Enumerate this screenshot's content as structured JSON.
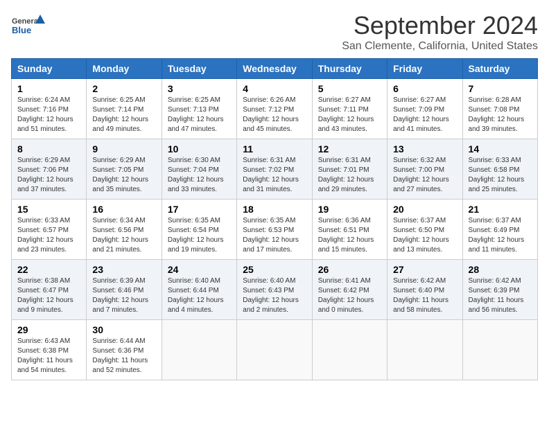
{
  "header": {
    "logo_general": "General",
    "logo_blue": "Blue",
    "month_title": "September 2024",
    "location": "San Clemente, California, United States"
  },
  "weekdays": [
    "Sunday",
    "Monday",
    "Tuesday",
    "Wednesday",
    "Thursday",
    "Friday",
    "Saturday"
  ],
  "weeks": [
    [
      {
        "day": "1",
        "sunrise": "6:24 AM",
        "sunset": "7:16 PM",
        "daylight": "12 hours and 51 minutes."
      },
      {
        "day": "2",
        "sunrise": "6:25 AM",
        "sunset": "7:14 PM",
        "daylight": "12 hours and 49 minutes."
      },
      {
        "day": "3",
        "sunrise": "6:25 AM",
        "sunset": "7:13 PM",
        "daylight": "12 hours and 47 minutes."
      },
      {
        "day": "4",
        "sunrise": "6:26 AM",
        "sunset": "7:12 PM",
        "daylight": "12 hours and 45 minutes."
      },
      {
        "day": "5",
        "sunrise": "6:27 AM",
        "sunset": "7:11 PM",
        "daylight": "12 hours and 43 minutes."
      },
      {
        "day": "6",
        "sunrise": "6:27 AM",
        "sunset": "7:09 PM",
        "daylight": "12 hours and 41 minutes."
      },
      {
        "day": "7",
        "sunrise": "6:28 AM",
        "sunset": "7:08 PM",
        "daylight": "12 hours and 39 minutes."
      }
    ],
    [
      {
        "day": "8",
        "sunrise": "6:29 AM",
        "sunset": "7:06 PM",
        "daylight": "12 hours and 37 minutes."
      },
      {
        "day": "9",
        "sunrise": "6:29 AM",
        "sunset": "7:05 PM",
        "daylight": "12 hours and 35 minutes."
      },
      {
        "day": "10",
        "sunrise": "6:30 AM",
        "sunset": "7:04 PM",
        "daylight": "12 hours and 33 minutes."
      },
      {
        "day": "11",
        "sunrise": "6:31 AM",
        "sunset": "7:02 PM",
        "daylight": "12 hours and 31 minutes."
      },
      {
        "day": "12",
        "sunrise": "6:31 AM",
        "sunset": "7:01 PM",
        "daylight": "12 hours and 29 minutes."
      },
      {
        "day": "13",
        "sunrise": "6:32 AM",
        "sunset": "7:00 PM",
        "daylight": "12 hours and 27 minutes."
      },
      {
        "day": "14",
        "sunrise": "6:33 AM",
        "sunset": "6:58 PM",
        "daylight": "12 hours and 25 minutes."
      }
    ],
    [
      {
        "day": "15",
        "sunrise": "6:33 AM",
        "sunset": "6:57 PM",
        "daylight": "12 hours and 23 minutes."
      },
      {
        "day": "16",
        "sunrise": "6:34 AM",
        "sunset": "6:56 PM",
        "daylight": "12 hours and 21 minutes."
      },
      {
        "day": "17",
        "sunrise": "6:35 AM",
        "sunset": "6:54 PM",
        "daylight": "12 hours and 19 minutes."
      },
      {
        "day": "18",
        "sunrise": "6:35 AM",
        "sunset": "6:53 PM",
        "daylight": "12 hours and 17 minutes."
      },
      {
        "day": "19",
        "sunrise": "6:36 AM",
        "sunset": "6:51 PM",
        "daylight": "12 hours and 15 minutes."
      },
      {
        "day": "20",
        "sunrise": "6:37 AM",
        "sunset": "6:50 PM",
        "daylight": "12 hours and 13 minutes."
      },
      {
        "day": "21",
        "sunrise": "6:37 AM",
        "sunset": "6:49 PM",
        "daylight": "12 hours and 11 minutes."
      }
    ],
    [
      {
        "day": "22",
        "sunrise": "6:38 AM",
        "sunset": "6:47 PM",
        "daylight": "12 hours and 9 minutes."
      },
      {
        "day": "23",
        "sunrise": "6:39 AM",
        "sunset": "6:46 PM",
        "daylight": "12 hours and 7 minutes."
      },
      {
        "day": "24",
        "sunrise": "6:40 AM",
        "sunset": "6:44 PM",
        "daylight": "12 hours and 4 minutes."
      },
      {
        "day": "25",
        "sunrise": "6:40 AM",
        "sunset": "6:43 PM",
        "daylight": "12 hours and 2 minutes."
      },
      {
        "day": "26",
        "sunrise": "6:41 AM",
        "sunset": "6:42 PM",
        "daylight": "12 hours and 0 minutes."
      },
      {
        "day": "27",
        "sunrise": "6:42 AM",
        "sunset": "6:40 PM",
        "daylight": "11 hours and 58 minutes."
      },
      {
        "day": "28",
        "sunrise": "6:42 AM",
        "sunset": "6:39 PM",
        "daylight": "11 hours and 56 minutes."
      }
    ],
    [
      {
        "day": "29",
        "sunrise": "6:43 AM",
        "sunset": "6:38 PM",
        "daylight": "11 hours and 54 minutes."
      },
      {
        "day": "30",
        "sunrise": "6:44 AM",
        "sunset": "6:36 PM",
        "daylight": "11 hours and 52 minutes."
      },
      null,
      null,
      null,
      null,
      null
    ]
  ]
}
